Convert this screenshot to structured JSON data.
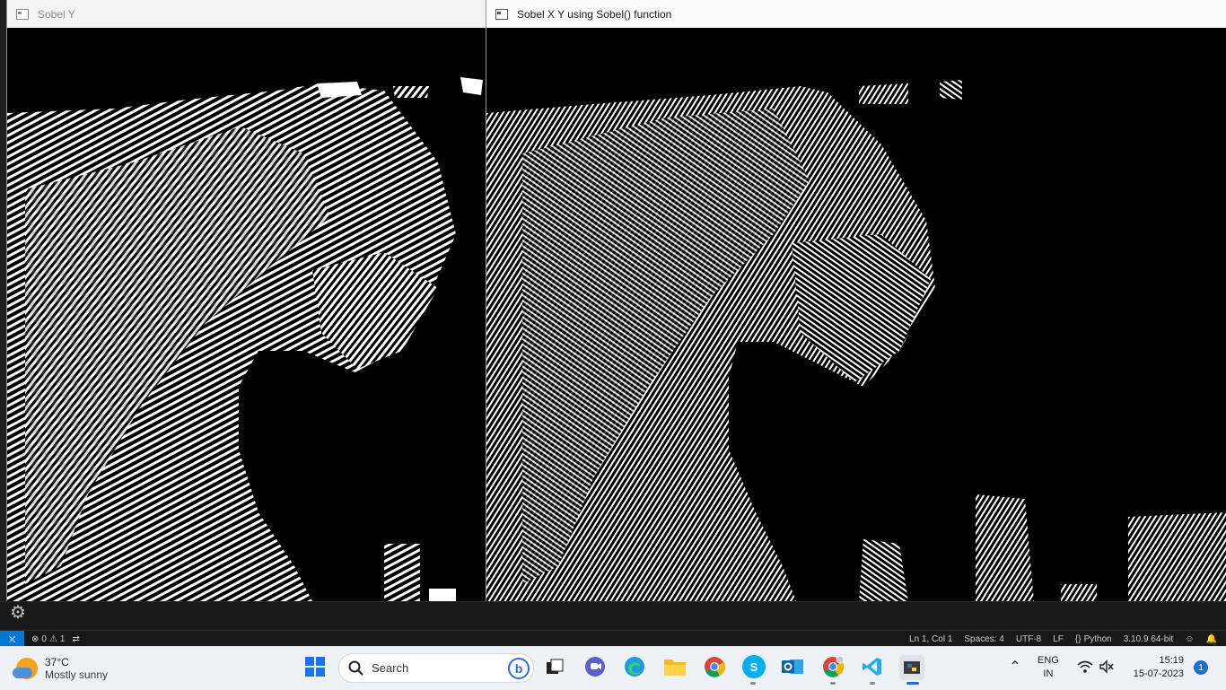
{
  "windows": {
    "left": {
      "title": "Sobel Y"
    },
    "right": {
      "title": "Sobel X Y using Sobel() function"
    }
  },
  "statusbar": {
    "errors": "0",
    "warnings": "1",
    "position": "Ln 1, Col 1",
    "spaces": "Spaces: 4",
    "encoding": "UTF-8",
    "eol": "LF",
    "language": "Python",
    "interpreter": "3.10.9 64-bit"
  },
  "taskbar": {
    "weather": {
      "temp": "37°C",
      "condition": "Mostly sunny"
    },
    "search_label": "Search",
    "lang_line1": "ENG",
    "lang_line2": "IN",
    "time": "15:19",
    "date": "15-07-2023",
    "notification_count": "1",
    "apps": [
      "task-view",
      "teams-chat",
      "edge",
      "file-explorer",
      "chrome",
      "skype",
      "outlook",
      "chrome-profile",
      "vscode",
      "python"
    ]
  },
  "colors": {
    "vscode_remote": "#0078d4",
    "taskbar_bg": "#eef1f6",
    "edge_image_fg": "#ffffff",
    "edge_image_bg": "#000000"
  }
}
